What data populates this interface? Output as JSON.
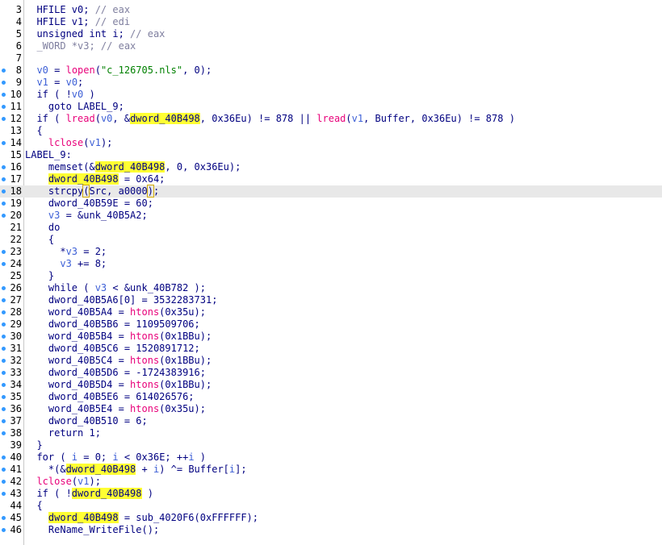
{
  "editor": {
    "lines": [
      {
        "num": "3",
        "dot": false,
        "current": false,
        "tokens": [
          {
            "t": "  HFILE v0; ",
            "c": "plain"
          },
          {
            "t": "// eax",
            "c": "comment"
          }
        ]
      },
      {
        "num": "4",
        "dot": false,
        "current": false,
        "tokens": [
          {
            "t": "  HFILE v1; ",
            "c": "plain"
          },
          {
            "t": "// edi",
            "c": "comment"
          }
        ]
      },
      {
        "num": "5",
        "dot": false,
        "current": false,
        "tokens": [
          {
            "t": "  unsigned int i; ",
            "c": "plain"
          },
          {
            "t": "// eax",
            "c": "comment"
          }
        ]
      },
      {
        "num": "6",
        "dot": false,
        "current": false,
        "tokens": [
          {
            "t": "  _WORD *v3; ",
            "c": "comment"
          },
          {
            "t": "// eax",
            "c": "comment"
          }
        ]
      },
      {
        "num": "7",
        "dot": false,
        "current": false,
        "tokens": []
      },
      {
        "num": "8",
        "dot": true,
        "current": false,
        "tokens": [
          {
            "t": "  ",
            "c": "plain"
          },
          {
            "t": "v0",
            "c": "var"
          },
          {
            "t": " = ",
            "c": "plain"
          },
          {
            "t": "lopen",
            "c": "func"
          },
          {
            "t": "(",
            "c": "plain"
          },
          {
            "t": "\"c_126705.nls\"",
            "c": "string"
          },
          {
            "t": ", 0);",
            "c": "plain"
          }
        ]
      },
      {
        "num": "9",
        "dot": true,
        "current": false,
        "tokens": [
          {
            "t": "  ",
            "c": "plain"
          },
          {
            "t": "v1",
            "c": "var"
          },
          {
            "t": " = ",
            "c": "plain"
          },
          {
            "t": "v0",
            "c": "var"
          },
          {
            "t": ";",
            "c": "plain"
          }
        ]
      },
      {
        "num": "10",
        "dot": true,
        "current": false,
        "tokens": [
          {
            "t": "  if ( !",
            "c": "plain"
          },
          {
            "t": "v0",
            "c": "var"
          },
          {
            "t": " )",
            "c": "plain"
          }
        ]
      },
      {
        "num": "11",
        "dot": true,
        "current": false,
        "tokens": [
          {
            "t": "    goto LABEL_9;",
            "c": "plain"
          }
        ]
      },
      {
        "num": "12",
        "dot": true,
        "current": false,
        "tokens": [
          {
            "t": "  if ( ",
            "c": "plain"
          },
          {
            "t": "lread",
            "c": "func"
          },
          {
            "t": "(",
            "c": "plain"
          },
          {
            "t": "v0",
            "c": "var"
          },
          {
            "t": ", &",
            "c": "plain"
          },
          {
            "t": "dword_40B498",
            "c": "hl"
          },
          {
            "t": ", 0x36Eu) != 878 || ",
            "c": "plain"
          },
          {
            "t": "lread",
            "c": "func"
          },
          {
            "t": "(",
            "c": "plain"
          },
          {
            "t": "v1",
            "c": "var"
          },
          {
            "t": ", Buffer, 0x36Eu) != 878 )",
            "c": "plain"
          }
        ]
      },
      {
        "num": "13",
        "dot": false,
        "current": false,
        "tokens": [
          {
            "t": "  {",
            "c": "plain"
          }
        ]
      },
      {
        "num": "14",
        "dot": true,
        "current": false,
        "tokens": [
          {
            "t": "    ",
            "c": "plain"
          },
          {
            "t": "lclose",
            "c": "func"
          },
          {
            "t": "(",
            "c": "plain"
          },
          {
            "t": "v1",
            "c": "var"
          },
          {
            "t": ");",
            "c": "plain"
          }
        ]
      },
      {
        "num": "15",
        "dot": false,
        "current": false,
        "tokens": [
          {
            "t": "LABEL_9:",
            "c": "plain"
          }
        ]
      },
      {
        "num": "16",
        "dot": true,
        "current": false,
        "tokens": [
          {
            "t": "    memset(&",
            "c": "plain"
          },
          {
            "t": "dword_40B498",
            "c": "hl"
          },
          {
            "t": ", 0, 0x36Eu);",
            "c": "plain"
          }
        ]
      },
      {
        "num": "17",
        "dot": true,
        "current": false,
        "tokens": [
          {
            "t": "    ",
            "c": "plain"
          },
          {
            "t": "dword_40B498",
            "c": "hl"
          },
          {
            "t": " = 0x64;",
            "c": "plain"
          }
        ]
      },
      {
        "num": "18",
        "dot": true,
        "current": true,
        "tokens": [
          {
            "t": "    strcpy",
            "c": "plain"
          },
          {
            "t": "(",
            "c": "box"
          },
          {
            "t": "Src, a0000",
            "c": "plain"
          },
          {
            "t": ")",
            "c": "box"
          },
          {
            "t": ";",
            "c": "plain"
          }
        ]
      },
      {
        "num": "19",
        "dot": true,
        "current": false,
        "tokens": [
          {
            "t": "    dword_40B59E = 60;",
            "c": "plain"
          }
        ]
      },
      {
        "num": "20",
        "dot": true,
        "current": false,
        "tokens": [
          {
            "t": "    ",
            "c": "plain"
          },
          {
            "t": "v3",
            "c": "var"
          },
          {
            "t": " = &unk_40B5A2;",
            "c": "plain"
          }
        ]
      },
      {
        "num": "21",
        "dot": false,
        "current": false,
        "tokens": [
          {
            "t": "    do",
            "c": "plain"
          }
        ]
      },
      {
        "num": "22",
        "dot": false,
        "current": false,
        "tokens": [
          {
            "t": "    {",
            "c": "plain"
          }
        ]
      },
      {
        "num": "23",
        "dot": true,
        "current": false,
        "tokens": [
          {
            "t": "      *",
            "c": "plain"
          },
          {
            "t": "v3",
            "c": "var"
          },
          {
            "t": " = 2;",
            "c": "plain"
          }
        ]
      },
      {
        "num": "24",
        "dot": true,
        "current": false,
        "tokens": [
          {
            "t": "      ",
            "c": "plain"
          },
          {
            "t": "v3",
            "c": "var"
          },
          {
            "t": " += 8;",
            "c": "plain"
          }
        ]
      },
      {
        "num": "25",
        "dot": false,
        "current": false,
        "tokens": [
          {
            "t": "    }",
            "c": "plain"
          }
        ]
      },
      {
        "num": "26",
        "dot": true,
        "current": false,
        "tokens": [
          {
            "t": "    while ( ",
            "c": "plain"
          },
          {
            "t": "v3",
            "c": "var"
          },
          {
            "t": " < &unk_40B782 );",
            "c": "plain"
          }
        ]
      },
      {
        "num": "27",
        "dot": true,
        "current": false,
        "tokens": [
          {
            "t": "    dword_40B5A6[0] = 3532283731;",
            "c": "plain"
          }
        ]
      },
      {
        "num": "28",
        "dot": true,
        "current": false,
        "tokens": [
          {
            "t": "    word_40B5A4 = ",
            "c": "plain"
          },
          {
            "t": "htons",
            "c": "func"
          },
          {
            "t": "(0x35u);",
            "c": "plain"
          }
        ]
      },
      {
        "num": "29",
        "dot": true,
        "current": false,
        "tokens": [
          {
            "t": "    dword_40B5B6 = 1109509706;",
            "c": "plain"
          }
        ]
      },
      {
        "num": "30",
        "dot": true,
        "current": false,
        "tokens": [
          {
            "t": "    word_40B5B4 = ",
            "c": "plain"
          },
          {
            "t": "htons",
            "c": "func"
          },
          {
            "t": "(0x1BBu);",
            "c": "plain"
          }
        ]
      },
      {
        "num": "31",
        "dot": true,
        "current": false,
        "tokens": [
          {
            "t": "    dword_40B5C6 = 1520891712;",
            "c": "plain"
          }
        ]
      },
      {
        "num": "32",
        "dot": true,
        "current": false,
        "tokens": [
          {
            "t": "    word_40B5C4 = ",
            "c": "plain"
          },
          {
            "t": "htons",
            "c": "func"
          },
          {
            "t": "(0x1BBu);",
            "c": "plain"
          }
        ]
      },
      {
        "num": "33",
        "dot": true,
        "current": false,
        "tokens": [
          {
            "t": "    dword_40B5D6 = -1724383916;",
            "c": "plain"
          }
        ]
      },
      {
        "num": "34",
        "dot": true,
        "current": false,
        "tokens": [
          {
            "t": "    word_40B5D4 = ",
            "c": "plain"
          },
          {
            "t": "htons",
            "c": "func"
          },
          {
            "t": "(0x1BBu);",
            "c": "plain"
          }
        ]
      },
      {
        "num": "35",
        "dot": true,
        "current": false,
        "tokens": [
          {
            "t": "    dword_40B5E6 = 614026576;",
            "c": "plain"
          }
        ]
      },
      {
        "num": "36",
        "dot": true,
        "current": false,
        "tokens": [
          {
            "t": "    word_40B5E4 = ",
            "c": "plain"
          },
          {
            "t": "htons",
            "c": "func"
          },
          {
            "t": "(0x35u);",
            "c": "plain"
          }
        ]
      },
      {
        "num": "37",
        "dot": true,
        "current": false,
        "tokens": [
          {
            "t": "    dword_40B510 = 6;",
            "c": "plain"
          }
        ]
      },
      {
        "num": "38",
        "dot": true,
        "current": false,
        "tokens": [
          {
            "t": "    return 1;",
            "c": "plain"
          }
        ]
      },
      {
        "num": "39",
        "dot": false,
        "current": false,
        "tokens": [
          {
            "t": "  }",
            "c": "plain"
          }
        ]
      },
      {
        "num": "40",
        "dot": true,
        "current": false,
        "tokens": [
          {
            "t": "  for ( ",
            "c": "plain"
          },
          {
            "t": "i",
            "c": "var"
          },
          {
            "t": " = 0; ",
            "c": "plain"
          },
          {
            "t": "i",
            "c": "var"
          },
          {
            "t": " < 0x36E; ++",
            "c": "plain"
          },
          {
            "t": "i",
            "c": "var"
          },
          {
            "t": " )",
            "c": "plain"
          }
        ]
      },
      {
        "num": "41",
        "dot": true,
        "current": false,
        "tokens": [
          {
            "t": "    *(&",
            "c": "plain"
          },
          {
            "t": "dword_40B498",
            "c": "hl"
          },
          {
            "t": " + ",
            "c": "plain"
          },
          {
            "t": "i",
            "c": "var"
          },
          {
            "t": ") ^= Buffer[",
            "c": "plain"
          },
          {
            "t": "i",
            "c": "var"
          },
          {
            "t": "];",
            "c": "plain"
          }
        ]
      },
      {
        "num": "42",
        "dot": true,
        "current": false,
        "tokens": [
          {
            "t": "  ",
            "c": "plain"
          },
          {
            "t": "lclose",
            "c": "func"
          },
          {
            "t": "(",
            "c": "plain"
          },
          {
            "t": "v1",
            "c": "var"
          },
          {
            "t": ");",
            "c": "plain"
          }
        ]
      },
      {
        "num": "43",
        "dot": true,
        "current": false,
        "tokens": [
          {
            "t": "  if ( !",
            "c": "plain"
          },
          {
            "t": "dword_40B498",
            "c": "hl"
          },
          {
            "t": " )",
            "c": "plain"
          }
        ]
      },
      {
        "num": "44",
        "dot": false,
        "current": false,
        "tokens": [
          {
            "t": "  {",
            "c": "plain"
          }
        ]
      },
      {
        "num": "45",
        "dot": true,
        "current": false,
        "tokens": [
          {
            "t": "    ",
            "c": "plain"
          },
          {
            "t": "dword_40B498",
            "c": "hl"
          },
          {
            "t": " = sub_4020F6(0xFFFFFF);",
            "c": "plain"
          }
        ]
      },
      {
        "num": "46",
        "dot": true,
        "current": false,
        "tokens": [
          {
            "t": "    ReName_WriteFile();",
            "c": "plain"
          }
        ]
      }
    ]
  }
}
